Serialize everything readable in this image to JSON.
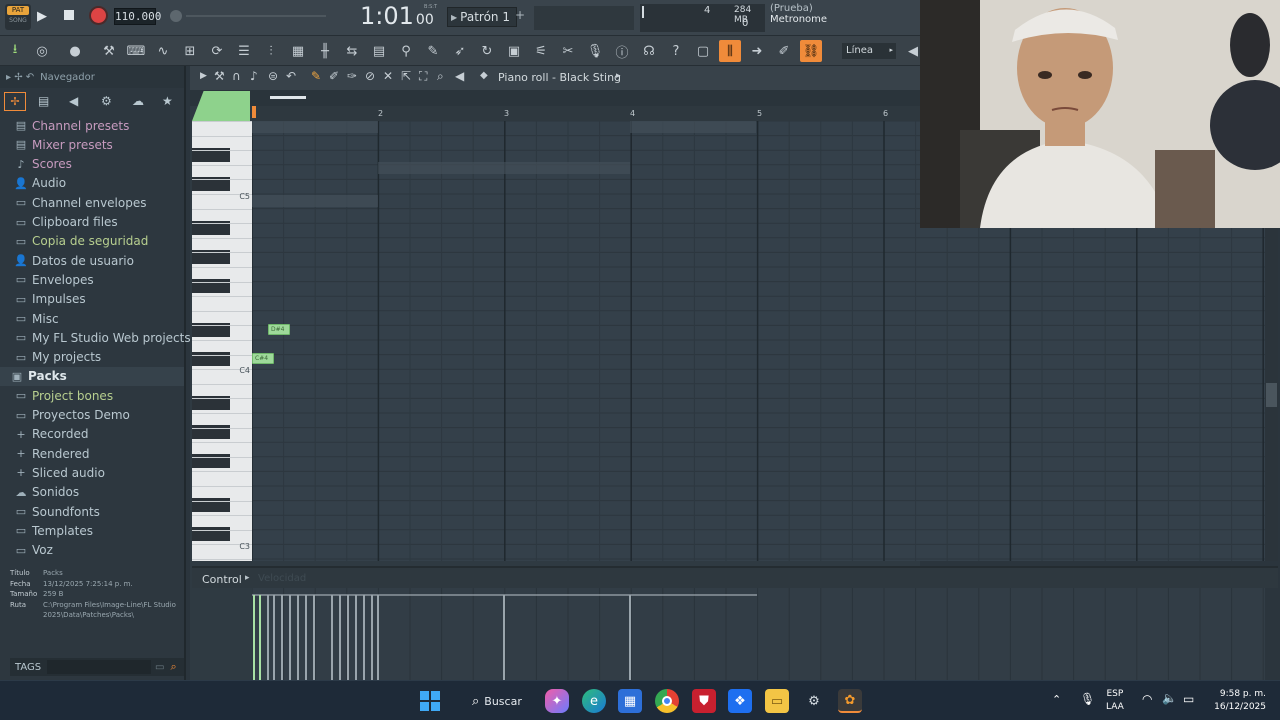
{
  "transport": {
    "pat_label": "PAT",
    "song_label": "SONG",
    "tempo": "110.000",
    "time": "1:01",
    "time_sub": "00",
    "time_unit": "B:S:T",
    "pattern": "Patrón 1",
    "cpu_value": "4",
    "memory": "284 MB",
    "poly": "0",
    "hint_title": "(Prueba)",
    "hint_text": "Metronome"
  },
  "toolbar": {
    "snap_label": "Línea"
  },
  "browser": {
    "title": "Navegador",
    "items": [
      {
        "label": "Channel presets",
        "icon": "▤",
        "style": "hl"
      },
      {
        "label": "Mixer presets",
        "icon": "▤",
        "style": "hl"
      },
      {
        "label": "Scores",
        "icon": "♪",
        "style": "hl"
      },
      {
        "label": "Audio",
        "icon": "👤",
        "style": ""
      },
      {
        "label": "Channel envelopes",
        "icon": "▭",
        "style": ""
      },
      {
        "label": "Clipboard files",
        "icon": "▭",
        "style": ""
      },
      {
        "label": "Copia de seguridad",
        "icon": "▭",
        "style": "yl"
      },
      {
        "label": "Datos de usuario",
        "icon": "👤",
        "style": ""
      },
      {
        "label": "Envelopes",
        "icon": "▭",
        "style": ""
      },
      {
        "label": "Impulses",
        "icon": "▭",
        "style": ""
      },
      {
        "label": "Misc",
        "icon": "▭",
        "style": ""
      },
      {
        "label": "My FL Studio Web projects",
        "icon": "▭",
        "style": ""
      },
      {
        "label": "My projects",
        "icon": "▭",
        "style": ""
      },
      {
        "label": "Packs",
        "icon": "▣",
        "style": "sel"
      },
      {
        "label": "Project bones",
        "icon": "▭",
        "style": "yl"
      },
      {
        "label": "Proyectos Demo",
        "icon": "▭",
        "style": ""
      },
      {
        "label": "Recorded",
        "icon": "+",
        "style": ""
      },
      {
        "label": "Rendered",
        "icon": "+",
        "style": ""
      },
      {
        "label": "Sliced audio",
        "icon": "+",
        "style": ""
      },
      {
        "label": "Sonidos",
        "icon": "☁",
        "style": ""
      },
      {
        "label": "Soundfonts",
        "icon": "▭",
        "style": ""
      },
      {
        "label": "Templates",
        "icon": "▭",
        "style": ""
      },
      {
        "label": "Voz",
        "icon": "▭",
        "style": ""
      }
    ],
    "info": {
      "title_label": "Título",
      "title_value": "Packs",
      "date_label": "Fecha",
      "date_value": "13/12/2025 7:25:14 p. m.",
      "size_label": "Tamaño",
      "size_value": "259 B",
      "path_label": "Ruta",
      "path_value": "C:\\Program Files\\Image-Line\\FL Studio 2025\\Data\\Patches\\Packs\\"
    },
    "tags_label": "TAGS"
  },
  "piano_roll": {
    "title": "Piano roll - Black Sting",
    "bar_numbers": [
      "2",
      "3",
      "4",
      "5",
      "6"
    ],
    "key_labels": [
      "C5",
      "C4",
      "C3"
    ],
    "notes": [
      "D#4",
      "C#4"
    ],
    "control_label": "Control",
    "control_param": "Velocidad"
  },
  "taskbar": {
    "search": "Buscar",
    "lang": "ESP",
    "lang2": "LAA",
    "time": "9:58 p. m.",
    "date": "16/12/2025"
  }
}
